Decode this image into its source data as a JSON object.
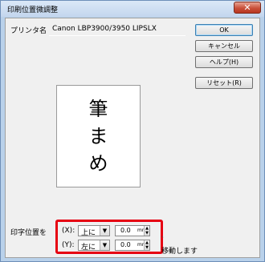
{
  "window": {
    "title": "印刷位置微調整",
    "close_glyph": "✕"
  },
  "printer": {
    "label": "プリンタ名",
    "name": "Canon LBP3900/3950 LIPSLX"
  },
  "preview": {
    "chars": [
      "筆",
      "ま",
      "め"
    ]
  },
  "buttons": {
    "ok": "OK",
    "cancel": "キャンセル",
    "help": "ヘルプ(H)",
    "reset": "リセット(R)"
  },
  "position": {
    "label": "印字位置を",
    "x_axis_label": "(X):",
    "x_direction": "上に",
    "x_value": "0.0",
    "x_unit": "mm",
    "y_axis_label": "(Y):",
    "y_direction": "左に",
    "y_value": "0.0",
    "y_unit": "mm",
    "suffix": "移動します",
    "tick": "、"
  },
  "icons": {
    "dropdown": "▼",
    "spin_up": "▲",
    "spin_down": "▼"
  },
  "colors": {
    "highlight": "#e60012"
  }
}
